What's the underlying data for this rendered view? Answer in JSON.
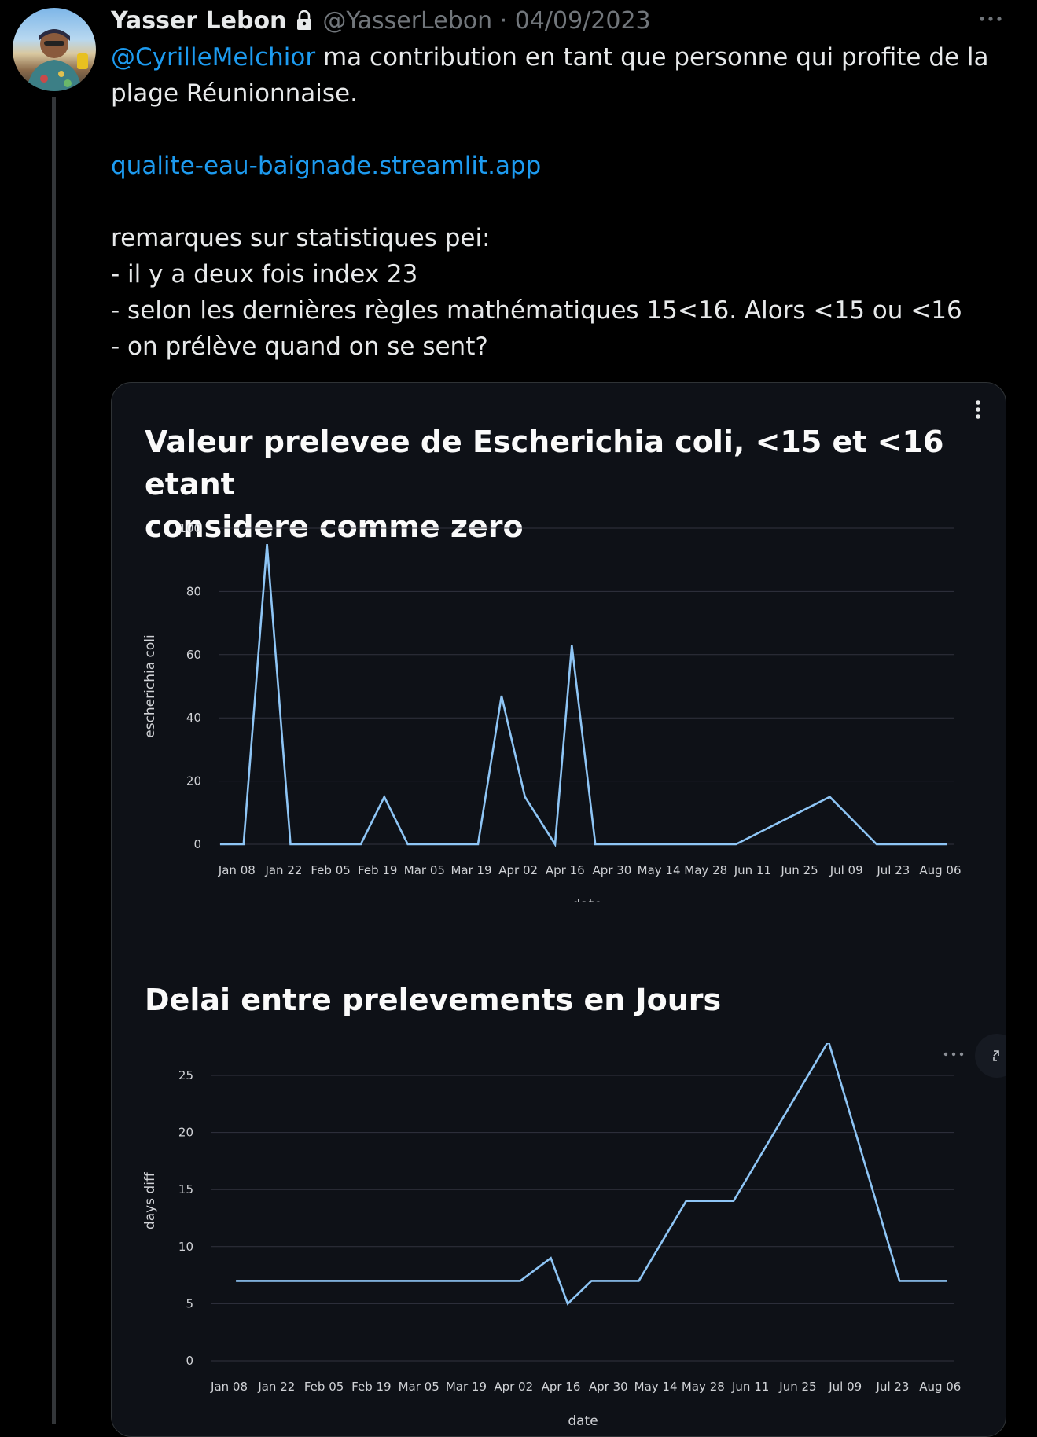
{
  "tweet": {
    "display_name": "Yasser Lebon",
    "handle_date": "@YasserLebon · 04/09/2023",
    "lines": [
      {
        "mention": "@CyrilleMelchior",
        "text": " ma contribution en tant que personne qui profite de la"
      },
      {
        "text": "plage Réunionnaise."
      },
      {
        "link": "qualite-eau-baignade.streamlit.app"
      },
      {
        "text": "remarques sur statistiques pei:"
      },
      {
        "text": "- il y a deux fois index 23"
      },
      {
        "text": "- selon les dernières règles mathématiques 15<16. Alors <15 ou <16"
      },
      {
        "text": "- on prélève quand on se sent?"
      }
    ]
  },
  "icons": {
    "lock": "lock-icon",
    "more": "more-horizontal-icon",
    "card_menu": "kebab-menu-icon",
    "chart_toolbar": "more-horizontal-icon",
    "expand": "expand-icon"
  },
  "colors": {
    "line": "#8ec5f5",
    "link": "#1d9bf0",
    "card_bg": "#0e1117"
  },
  "chart_data": [
    {
      "type": "line",
      "title_line1": "Valeur prelevee de Escherichia coli, <15 et <16 etant",
      "title_line2": "considere comme zero",
      "xlabel": "date",
      "ylabel": "escherichia coli",
      "ylim": [
        0,
        100
      ],
      "yticks": [
        "0",
        "20",
        "40",
        "60",
        "80",
        "100"
      ],
      "xticks": [
        "Jan 08",
        "Jan 22",
        "Feb 05",
        "Feb 19",
        "Mar 05",
        "Mar 19",
        "Apr 02",
        "Apr 16",
        "Apr 30",
        "May 14",
        "May 28",
        "Jun 11",
        "Jun 25",
        "Jul 09",
        "Jul 23",
        "Aug 06"
      ],
      "x": [
        "2023-01-03",
        "2023-01-10",
        "2023-01-17",
        "2023-01-24",
        "2023-01-31",
        "2023-02-07",
        "2023-02-14",
        "2023-02-21",
        "2023-02-28",
        "2023-03-07",
        "2023-03-14",
        "2023-03-21",
        "2023-03-28",
        "2023-04-04",
        "2023-04-13",
        "2023-04-18",
        "2023-04-25",
        "2023-05-02",
        "2023-05-09",
        "2023-05-23",
        "2023-06-06",
        "2023-07-04",
        "2023-07-18",
        "2023-07-25",
        "2023-08-01",
        "2023-08-08"
      ],
      "series": [
        {
          "values": [
            0,
            0,
            95,
            0,
            0,
            0,
            0,
            15,
            0,
            0,
            0,
            0,
            47,
            15,
            0,
            63,
            0,
            0,
            0,
            0,
            0,
            15,
            0,
            0,
            0,
            0
          ]
        }
      ],
      "grid": true
    },
    {
      "type": "line",
      "title": "Delai entre prelevements en Jours",
      "xlabel": "date",
      "ylabel": "days diff",
      "ylim": [
        0,
        28
      ],
      "yticks": [
        "0",
        "5",
        "10",
        "15",
        "20",
        "25"
      ],
      "xticks": [
        "Jan 08",
        "Jan 22",
        "Feb 05",
        "Feb 19",
        "Mar 05",
        "Mar 19",
        "Apr 02",
        "Apr 16",
        "Apr 30",
        "May 14",
        "May 28",
        "Jun 11",
        "Jun 25",
        "Jul 09",
        "Jul 23",
        "Aug 06"
      ],
      "x": [
        "2023-01-10",
        "2023-01-17",
        "2023-01-24",
        "2023-01-31",
        "2023-02-07",
        "2023-02-14",
        "2023-02-21",
        "2023-02-28",
        "2023-03-07",
        "2023-03-14",
        "2023-03-21",
        "2023-03-28",
        "2023-04-04",
        "2023-04-13",
        "2023-04-18",
        "2023-04-25",
        "2023-05-02",
        "2023-05-09",
        "2023-05-23",
        "2023-06-06",
        "2023-07-04",
        "2023-07-18",
        "2023-07-25",
        "2023-08-01",
        "2023-08-08"
      ],
      "series": [
        {
          "values": [
            7,
            7,
            7,
            7,
            7,
            7,
            7,
            7,
            7,
            7,
            7,
            7,
            7,
            9,
            5,
            7,
            7,
            7,
            14,
            14,
            28,
            14,
            7,
            7,
            7
          ]
        }
      ],
      "grid": true
    }
  ]
}
